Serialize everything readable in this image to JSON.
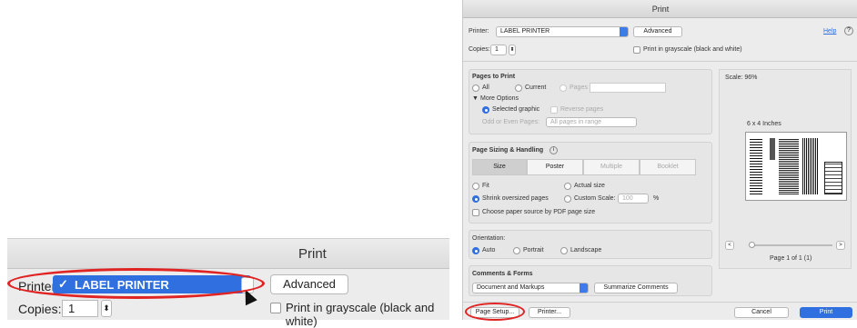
{
  "zoom": {
    "title": "Print",
    "printer_label": "Printer",
    "printer_value": "LABEL PRINTER",
    "checkmark": "✓",
    "advanced_label": "Advanced",
    "copies_label": "Copies:",
    "copies_value": "1",
    "grayscale_label": "Print in grayscale (black and white)"
  },
  "dialog": {
    "title": "Print",
    "printer_label": "Printer:",
    "printer_value": "LABEL PRINTER",
    "advanced_label": "Advanced",
    "help_label": "Help",
    "copies_label": "Copies:",
    "copies_value": "1",
    "grayscale_label": "Print in grayscale (black and white)",
    "pages_to_print": {
      "heading": "Pages to Print",
      "all": "All",
      "current": "Current",
      "pages": "Pages",
      "more_options": "More Options",
      "selected_graphic": "Selected graphic",
      "reverse_pages": "Reverse pages",
      "odd_even_label": "Odd or Even Pages:",
      "odd_even_value": "All pages in range"
    },
    "sizing": {
      "heading": "Page Sizing & Handling",
      "tabs": [
        "Size",
        "Poster",
        "Multiple",
        "Booklet"
      ],
      "fit": "Fit",
      "actual_size": "Actual size",
      "shrink": "Shrink oversized pages",
      "custom_scale": "Custom Scale:",
      "custom_scale_value": "100",
      "percent": "%",
      "paper_source": "Choose paper source by PDF page size"
    },
    "orientation": {
      "heading": "Orientation:",
      "auto": "Auto",
      "portrait": "Portrait",
      "landscape": "Landscape"
    },
    "comments": {
      "heading": "Comments & Forms",
      "value": "Document and Markups",
      "summarize": "Summarize Comments"
    },
    "preview": {
      "scale": "Scale: 96%",
      "size": "6 x 4 Inches",
      "page_info": "Page 1 of 1 (1)",
      "prev": "<",
      "next": ">"
    },
    "footer": {
      "page_setup": "Page Setup...",
      "printer": "Printer...",
      "cancel": "Cancel",
      "print": "Print"
    },
    "accent_color": "#2f6fe0",
    "highlight_color": "#e02424"
  }
}
